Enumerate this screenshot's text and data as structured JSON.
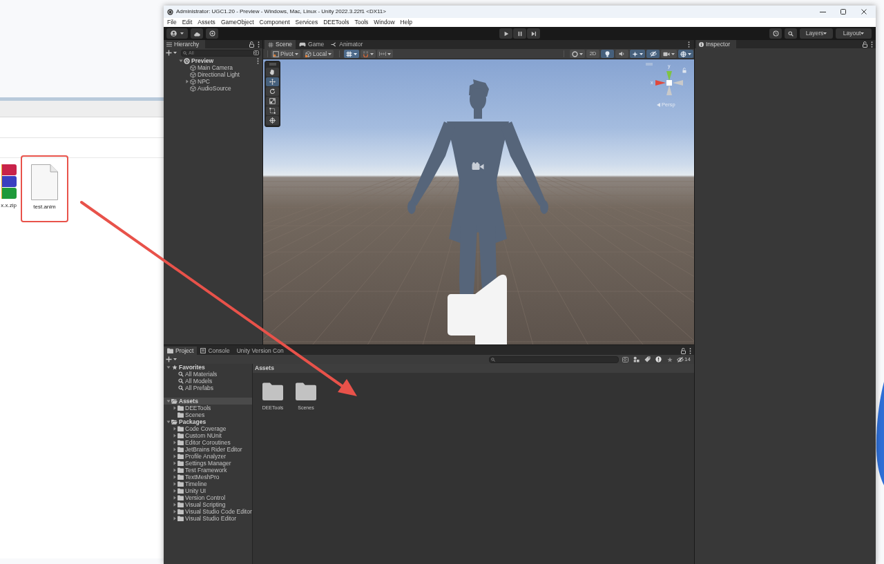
{
  "desktop": {
    "explorer": {
      "files": [
        {
          "name": "x.x.zip",
          "kind": "archive",
          "highlighted": false
        },
        {
          "name": "test.anim",
          "kind": "document",
          "highlighted": true
        }
      ]
    }
  },
  "unity": {
    "title": "Administrator: UGC1.20 - Preview - Windows, Mac, Linux - Unity 2022.3.22f1 <DX11>",
    "menu": [
      "File",
      "Edit",
      "Assets",
      "GameObject",
      "Component",
      "Services",
      "DEETools",
      "Tools",
      "Window",
      "Help"
    ],
    "toolbar": {
      "layers": "Layers",
      "layout": "Layout"
    },
    "hierarchy": {
      "tab": "Hierarchy",
      "search": {
        "placeholder": "All"
      },
      "items": [
        {
          "label": "Preview",
          "kind": "scene",
          "expanded": true,
          "selected": false,
          "children": [
            {
              "label": "Main Camera",
              "kind": "object",
              "selected": false
            },
            {
              "label": "Directional Light",
              "kind": "object",
              "selected": false
            },
            {
              "label": "NPC",
              "kind": "object",
              "expanded": false,
              "selected": false
            },
            {
              "label": "AudioSource",
              "kind": "object",
              "selected": false
            }
          ]
        }
      ]
    },
    "scene_view": {
      "tabs": [
        {
          "label": "Scene",
          "kind": "scene",
          "selected": true
        },
        {
          "label": "Game",
          "kind": "game",
          "selected": false
        },
        {
          "label": "Animator",
          "kind": "animator",
          "selected": false
        }
      ],
      "pivot": "Pivot",
      "space": "Local",
      "snap_buttons": [
        {
          "kind": "grid",
          "on": true
        },
        {
          "kind": "snap",
          "on": false
        },
        {
          "kind": "increment",
          "on": false
        }
      ],
      "view_buttons": [
        {
          "kind": "shading",
          "on": false
        },
        {
          "kind": "mode_2d",
          "label": "2D",
          "on": false
        },
        {
          "kind": "lighting",
          "on": true
        },
        {
          "kind": "audio",
          "on": false
        },
        {
          "kind": "effects",
          "on": true
        },
        {
          "kind": "visibility",
          "on": true
        },
        {
          "kind": "camera",
          "on": false
        },
        {
          "kind": "gizmos",
          "on": true
        }
      ],
      "tools": [
        {
          "kind": "hand",
          "selected": false
        },
        {
          "kind": "move",
          "selected": true
        },
        {
          "kind": "rotate",
          "selected": false
        },
        {
          "kind": "scale",
          "selected": false
        },
        {
          "kind": "rect",
          "selected": false
        },
        {
          "kind": "transform",
          "selected": false
        }
      ],
      "gizmo": {
        "y_label": "y",
        "x_label": "x",
        "projection": "Persp"
      }
    },
    "inspector": {
      "tab": "Inspector"
    },
    "project": {
      "tabs": [
        {
          "label": "Project",
          "kind": "project",
          "selected": true
        },
        {
          "label": "Console",
          "kind": "console",
          "selected": false
        },
        {
          "label": "Unity Version Con",
          "kind": "version_control",
          "selected": false
        }
      ],
      "hidden_count": "14",
      "tree": [
        {
          "label": "Favorites",
          "kind": "favorites",
          "expanded": true,
          "selected": false,
          "children": [
            {
              "label": "All Materials",
              "kind": "search",
              "selected": false
            },
            {
              "label": "All Models",
              "kind": "search",
              "selected": false
            },
            {
              "label": "All Prefabs",
              "kind": "search",
              "selected": false
            }
          ]
        },
        {
          "label": "Assets",
          "kind": "folder",
          "expanded": true,
          "selected": true,
          "children": [
            {
              "label": "DEETools",
              "kind": "folder",
              "expanded": false,
              "selected": false
            },
            {
              "label": "Scenes",
              "kind": "folder",
              "selected": false
            }
          ]
        },
        {
          "label": "Packages",
          "kind": "folder",
          "expanded": true,
          "selected": false,
          "children": [
            {
              "label": "Code Coverage",
              "kind": "folder",
              "expanded": false,
              "selected": false
            },
            {
              "label": "Custom NUnit",
              "kind": "folder",
              "expanded": false,
              "selected": false
            },
            {
              "label": "Editor Coroutines",
              "kind": "folder",
              "expanded": false,
              "selected": false
            },
            {
              "label": "JetBrains Rider Editor",
              "kind": "folder",
              "expanded": false,
              "selected": false
            },
            {
              "label": "Profile Analyzer",
              "kind": "folder",
              "expanded": false,
              "selected": false
            },
            {
              "label": "Settings Manager",
              "kind": "folder",
              "expanded": false,
              "selected": false
            },
            {
              "label": "Test Framework",
              "kind": "folder",
              "expanded": false,
              "selected": false
            },
            {
              "label": "TextMeshPro",
              "kind": "folder",
              "expanded": false,
              "selected": false
            },
            {
              "label": "Timeline",
              "kind": "folder",
              "expanded": false,
              "selected": false
            },
            {
              "label": "Unity UI",
              "kind": "folder",
              "expanded": false,
              "selected": false
            },
            {
              "label": "Version Control",
              "kind": "folder",
              "expanded": false,
              "selected": false
            },
            {
              "label": "Visual Scripting",
              "kind": "folder",
              "expanded": false,
              "selected": false
            },
            {
              "label": "Visual Studio Code Editor",
              "kind": "folder",
              "expanded": false,
              "selected": false
            },
            {
              "label": "Visual Studio Editor",
              "kind": "folder",
              "expanded": false,
              "selected": false
            }
          ]
        }
      ],
      "breadcrumb": "Assets",
      "assets": [
        {
          "name": "DEETools",
          "kind": "folder"
        },
        {
          "name": "Scenes",
          "kind": "folder"
        }
      ]
    }
  }
}
